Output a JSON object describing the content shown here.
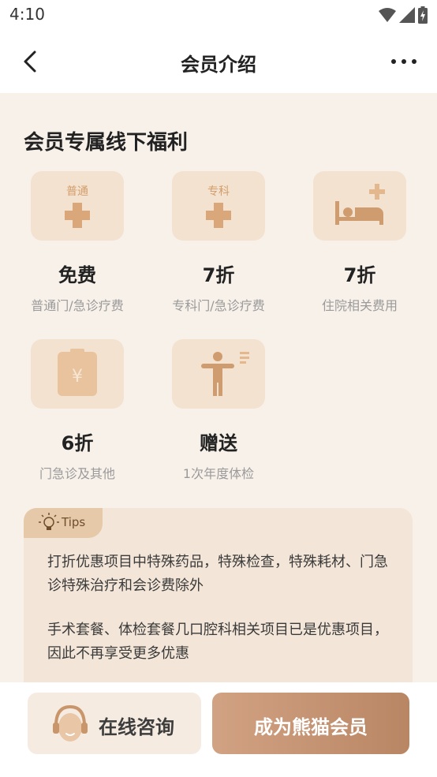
{
  "status": {
    "time": "4:10",
    "icons": [
      "wifi-icon",
      "signal-icon",
      "battery-charging-icon"
    ]
  },
  "header": {
    "title": "会员介绍",
    "back_icon": "back-arrow-icon",
    "more_icon": "more-dots-icon"
  },
  "section": {
    "title": "会员专属线下福利"
  },
  "benefits": [
    {
      "icon": "general-clinic-cross-icon",
      "icon_label": "普通",
      "value": "免费",
      "desc": "普通门/急诊疗费"
    },
    {
      "icon": "specialist-clinic-cross-icon",
      "icon_label": "专科",
      "value": "7折",
      "desc": "专科门/急诊疗费"
    },
    {
      "icon": "hospital-bed-icon",
      "value": "7折",
      "desc": "住院相关费用"
    },
    {
      "icon": "yuan-voucher-icon",
      "icon_label": "¥",
      "value": "6折",
      "desc": "门急诊及其他"
    },
    {
      "icon": "body-checkup-icon",
      "value": "赠送",
      "desc": "1次年度体检"
    }
  ],
  "tips": {
    "badge": "Tips",
    "badge_icon": "lightbulb-icon",
    "paragraphs": [
      "打折优惠项目中特殊药品，特殊检查，特殊耗材、门急诊特殊治疗和会诊费除外",
      "手术套餐、体检套餐几口腔科相关项目已是优惠项目，因此不再享受更多优惠"
    ]
  },
  "actions": {
    "consult_label": "在线咨询",
    "consult_icon": "customer-service-headset-icon",
    "join_label": "成为熊猫会员"
  },
  "colors": {
    "page_bg": "#f8f1ea",
    "icon_box": "#f3e2cf",
    "icon_fill": "#d9a77a",
    "tips_bg": "#f3e6d8",
    "tips_badge": "#e6c9a8",
    "primary_start": "#d1a283",
    "primary_end": "#b98664"
  }
}
